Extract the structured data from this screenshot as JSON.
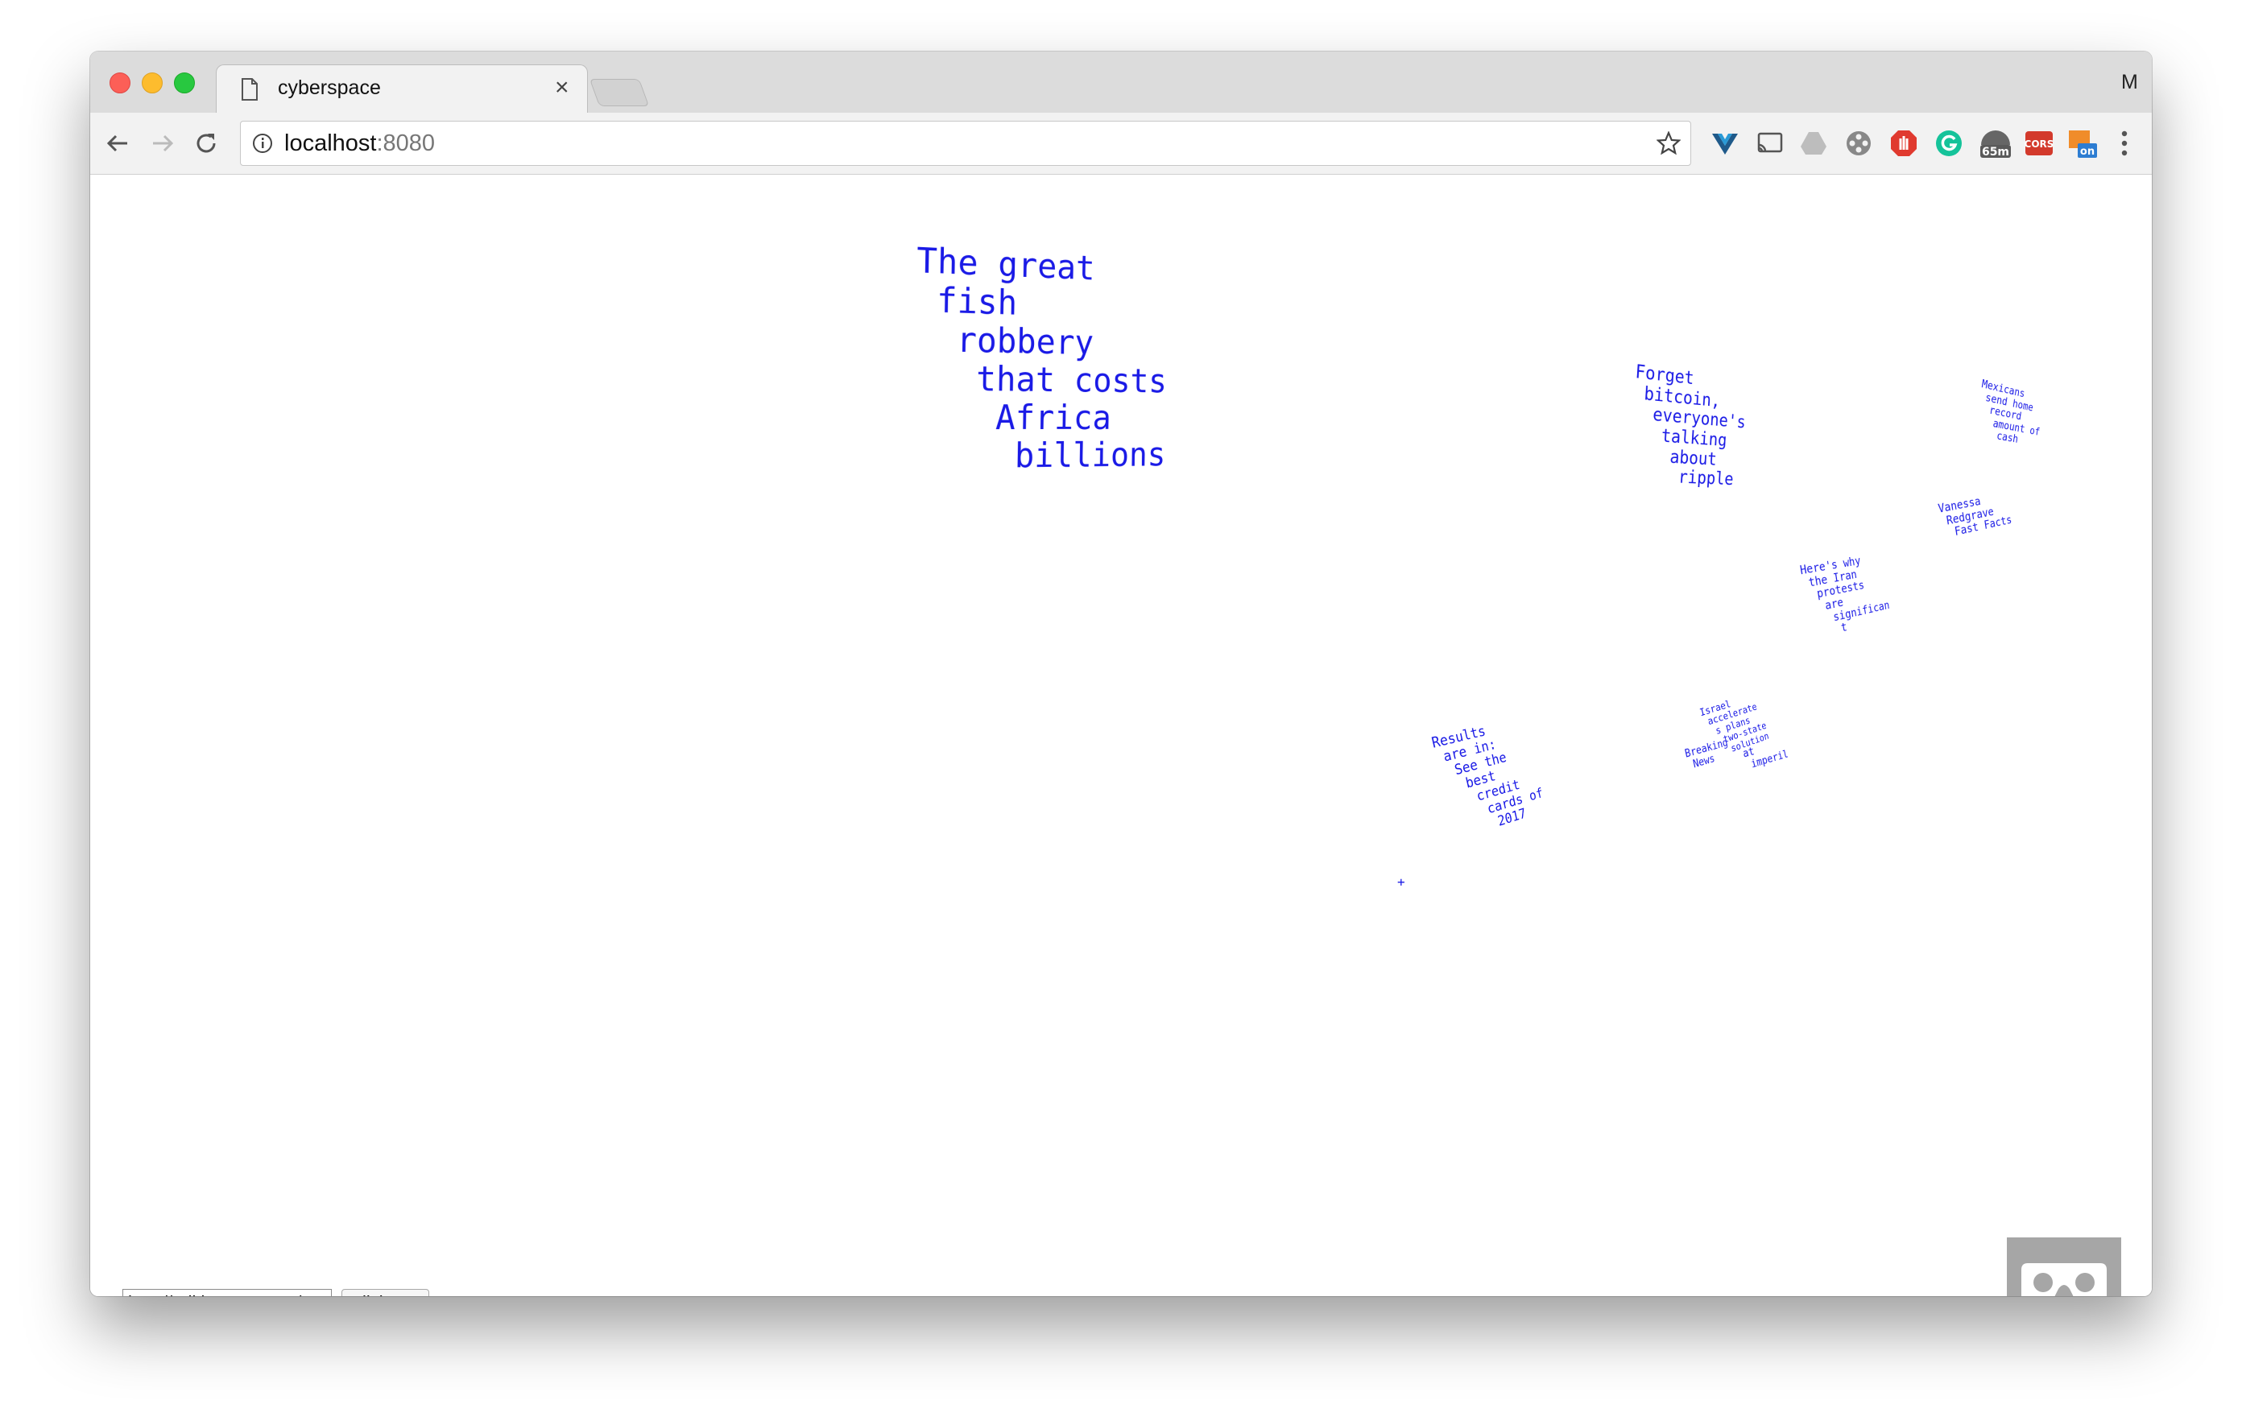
{
  "browser": {
    "tab_title": "cyberspace",
    "tab_close": "×",
    "profile_initial": "M",
    "url_host": "localhost",
    "url_port": ":8080",
    "extension_badges": {
      "timer": "65m",
      "cors": "CORS",
      "toggle": "on"
    }
  },
  "scene": {
    "headlines": [
      "The great\n fish\n  robbery\n   that costs\n    Africa\n     billions",
      "Forget\n bitcoin,\n  everyone's\n   talking\n    about\n     ripple",
      "Mexicans\n send home\n  record\n   amount of\n    cash",
      "Vanessa\n Redgrave\n  Fast Facts",
      "Here's why\n the Iran\n  protests\n   are\n    significan\n     t",
      "Israel\n accelerate\n  s plans\n   two-state\n    solution",
      "Breaking\n News",
      "at\n imperil",
      "Results\n are in:\n  See the\n   best\n    credit\n     cards of\n      2017"
    ],
    "cursor": "+"
  },
  "controls": {
    "url_value": "http://edition.cnn.com/w",
    "button_label": "click me"
  }
}
